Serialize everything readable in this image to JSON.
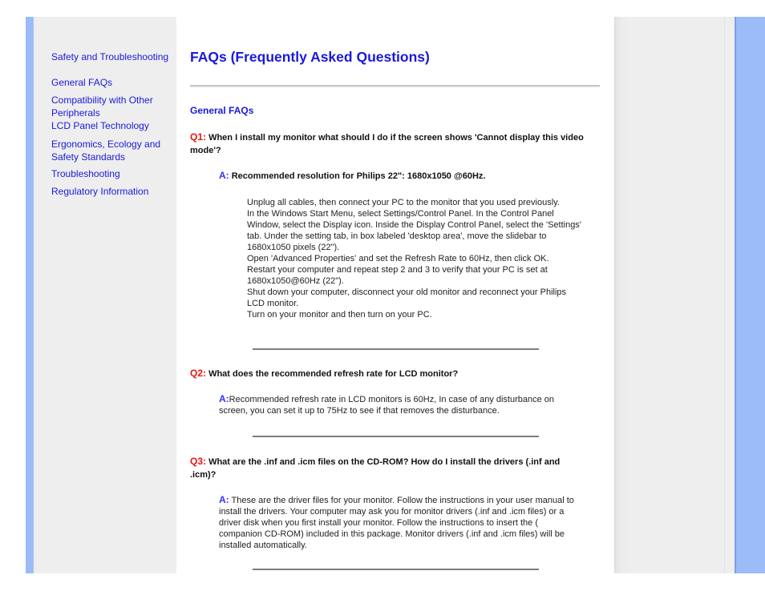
{
  "sidebar": {
    "items": [
      {
        "label": "Safety and Troubleshooting"
      },
      {
        "label": "General FAQs"
      },
      {
        "label": "Compatibility with Other Peripherals"
      },
      {
        "label": "LCD Panel Technology"
      },
      {
        "label": "Ergonomics, Ecology and Safety Standards"
      },
      {
        "label": "Troubleshooting"
      },
      {
        "label": "Regulatory Information"
      }
    ]
  },
  "main": {
    "title": "FAQs (Frequently Asked Questions)",
    "section_title": "General FAQs",
    "faqs": [
      {
        "q_label": "Q1:",
        "question": " When I install my monitor what should I do if the screen shows 'Cannot display this video mode'?",
        "a_label": "A:",
        "answer": " Recommended resolution for Philips 22\": 1680x1050 @60Hz.",
        "steps": [
          "Unplug all cables, then connect your PC to the monitor that you used previously.",
          "In the Windows Start Menu, select Settings/Control Panel. In the Control Panel Window, select the Display icon. Inside the Display Control Panel, select the 'Settings' tab. Under the setting tab, in box labeled 'desktop area', move the slidebar to 1680x1050 pixels (22\").",
          "Open 'Advanced Properties' and set the Refresh Rate to 60Hz, then click OK.",
          "Restart your computer and repeat step 2 and 3 to verify that your PC is set at 1680x1050@60Hz (22\").",
          "Shut down your computer, disconnect your old monitor and reconnect your Philips LCD monitor.",
          "Turn on your monitor and then turn on your PC."
        ]
      },
      {
        "q_label": "Q2:",
        "question": " What does the recommended refresh rate for LCD monitor?",
        "a_label": "A:",
        "answer": "Recommended refresh rate in LCD monitors is 60Hz, In case of any disturbance on screen, you can set it up to 75Hz to see if that removes the disturbance."
      },
      {
        "q_label": "Q3:",
        "question": " What are the .inf and .icm files on the CD-ROM? How do I install the drivers (.inf and .icm)?",
        "a_label": "A:",
        "answer": " These are the driver files for your monitor. Follow the instructions in your user manual to install the drivers. Your computer may ask you for monitor drivers (.inf and .icm files) or a driver disk when you first install your monitor. Follow the instructions to insert the ( companion CD-ROM) included in this package. Monitor drivers (.inf and .icm files) will be installed automatically."
      }
    ]
  },
  "colors": {
    "link": "#1a1ad9",
    "question_label": "#ee1111",
    "answer_label": "#3333ee",
    "sidebar_bg": "#eeeeee",
    "accent_strip": "#9bbbf9"
  }
}
